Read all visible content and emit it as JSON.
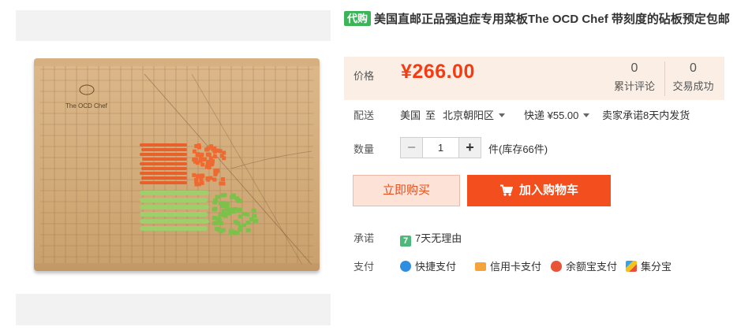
{
  "product": {
    "tag": "代购",
    "title": "美国直邮正品强迫症专用菜板The OCD Chef 带刻度的砧板预定包邮",
    "board_brand": "The OCD Chef"
  },
  "price": {
    "label": "价格",
    "value": "¥266.00",
    "reviews_count": "0",
    "reviews_label": "累计评论",
    "deals_count": "0",
    "deals_label": "交易成功"
  },
  "shipping": {
    "label": "配送",
    "from": "美国",
    "to_word": "至",
    "destination": "北京朝阳区",
    "method": "快递 ¥55.00",
    "promise": "卖家承诺8天内发货"
  },
  "quantity": {
    "label": "数量",
    "minus": "−",
    "value": "1",
    "plus": "+",
    "stock": "件(库存66件)"
  },
  "actions": {
    "buy_now": "立即购买",
    "add_to_cart": "加入购物车"
  },
  "promise": {
    "label": "承诺",
    "icon_text": "7",
    "text": "7天无理由"
  },
  "payment": {
    "label": "支付",
    "methods": [
      "快捷支付",
      "信用卡支付",
      "余额宝支付",
      "集分宝"
    ]
  },
  "colors": {
    "accent": "#f24e1e",
    "price": "#f23c14",
    "tag_green": "#3cb55a",
    "price_panel_bg": "#fbeee5"
  },
  "icons": [
    "cart-icon",
    "seven-day-return-icon",
    "quick-pay-icon",
    "credit-card-icon",
    "yuebao-icon",
    "jifenbao-icon"
  ]
}
